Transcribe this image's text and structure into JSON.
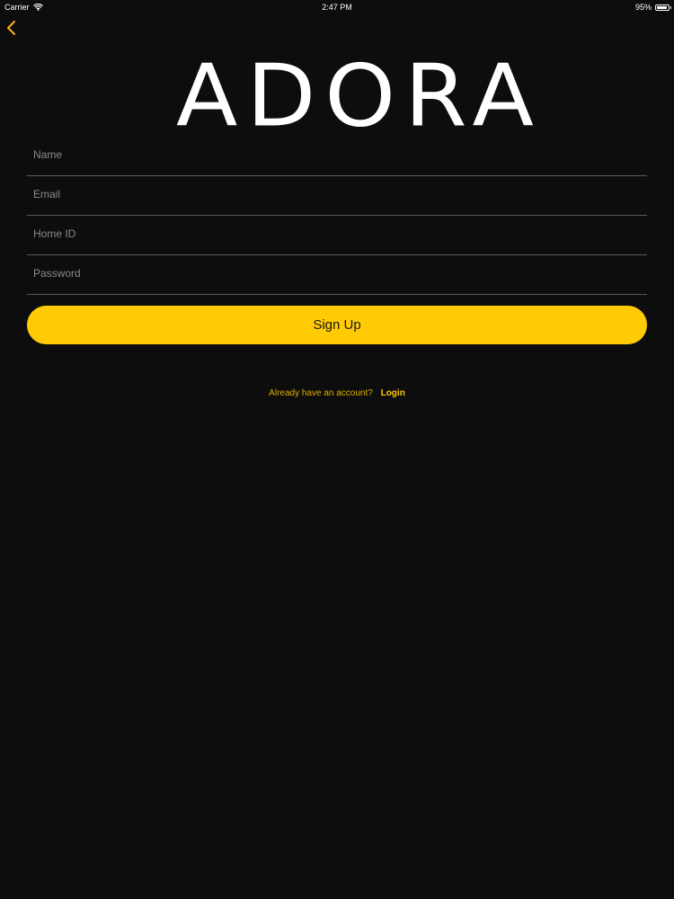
{
  "status_bar": {
    "carrier": "Carrier",
    "time": "2:47 PM",
    "battery": "95%",
    "battery_level": 0.95
  },
  "nav": {
    "back_icon": "chevron-left-icon",
    "accent_color": "#ffcb05"
  },
  "logo": {
    "text": "ADORA",
    "icon": "house-wifi-icon"
  },
  "form": {
    "name": {
      "placeholder": "Name",
      "value": ""
    },
    "email": {
      "placeholder": "Email",
      "value": ""
    },
    "home_id": {
      "placeholder": "Home ID",
      "value": ""
    },
    "password": {
      "placeholder": "Password",
      "value": ""
    }
  },
  "signup_button": {
    "label": "Sign Up",
    "color": "#ffcb05"
  },
  "login_prompt": {
    "text": "Already have an account?",
    "link": "Login"
  }
}
